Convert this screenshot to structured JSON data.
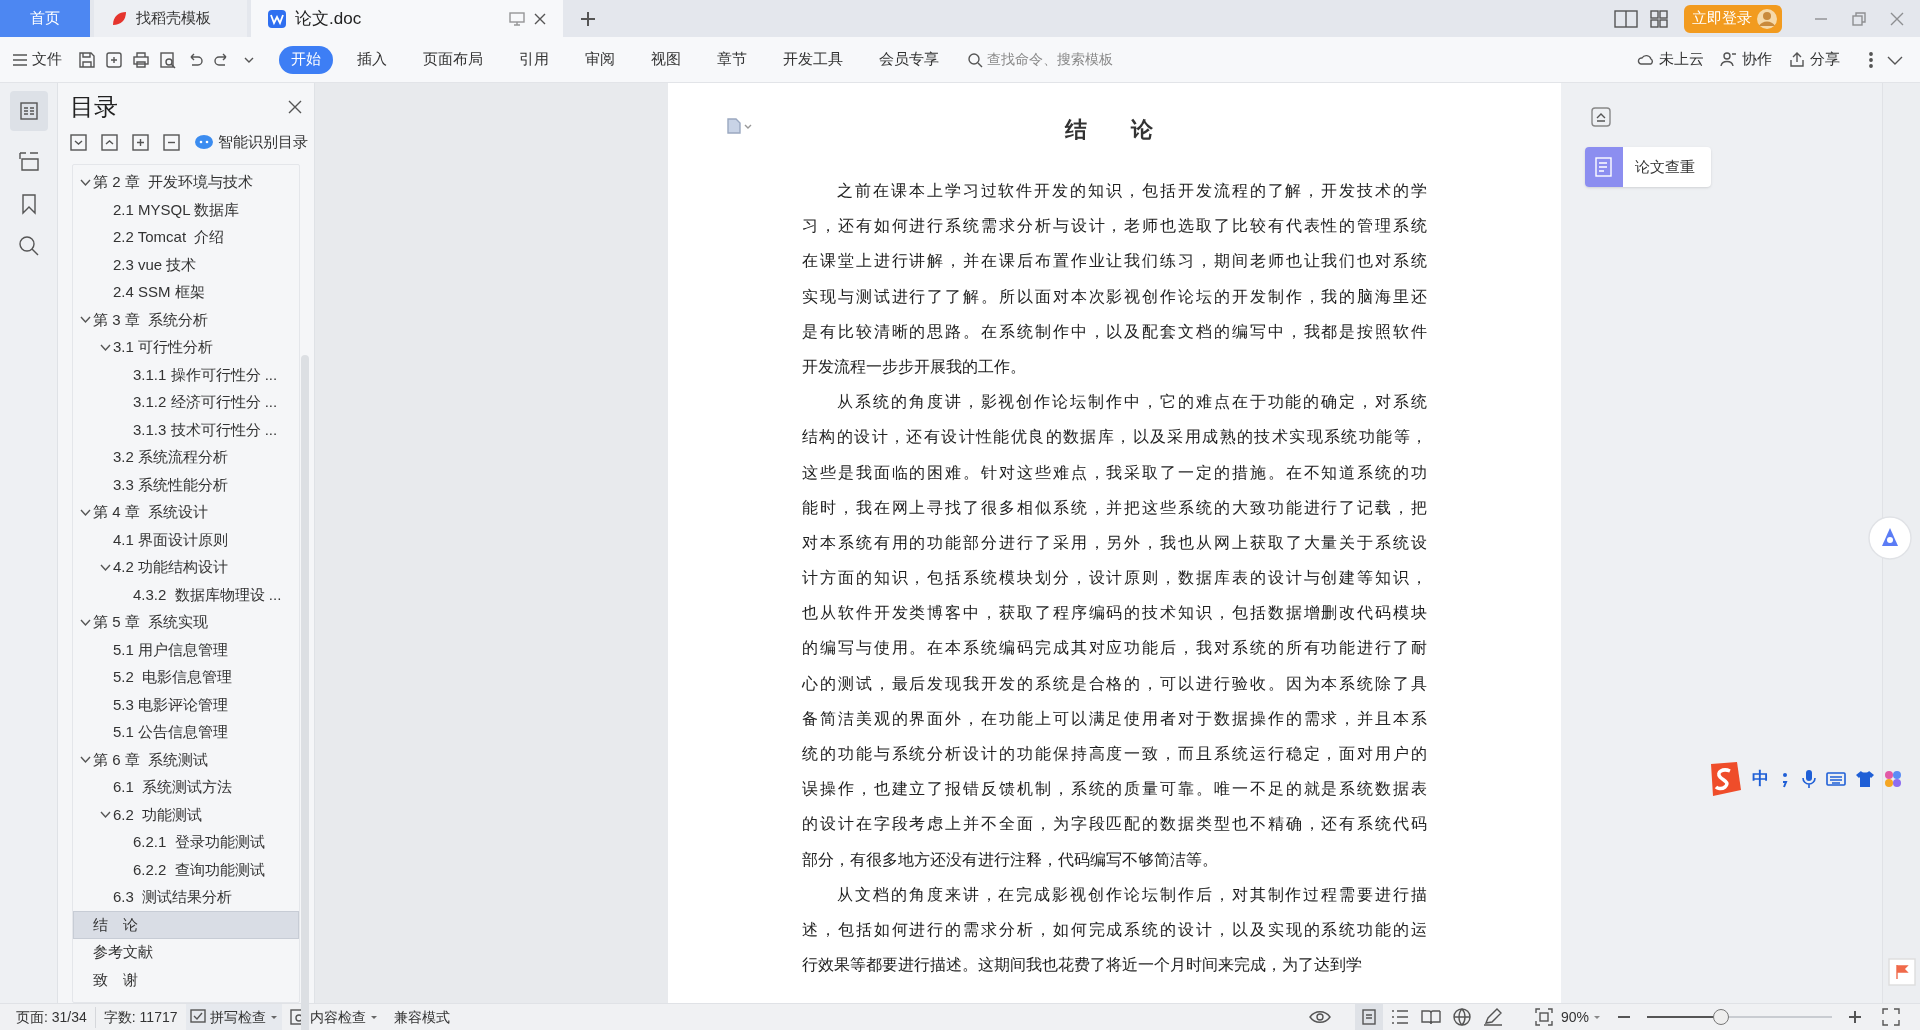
{
  "tabs": [
    {
      "label": "首页",
      "kind": "home",
      "selected": false
    },
    {
      "label": "找稻壳模板",
      "kind": "template",
      "selected": false
    },
    {
      "label": "论文.doc",
      "kind": "document",
      "selected": true
    }
  ],
  "login_button": "立即登录",
  "toolbar": {
    "file_menu": "文件",
    "tabs": [
      {
        "label": "开始",
        "selected": true
      },
      {
        "label": "插入",
        "selected": false
      },
      {
        "label": "页面布局",
        "selected": false
      },
      {
        "label": "引用",
        "selected": false
      },
      {
        "label": "审阅",
        "selected": false
      },
      {
        "label": "视图",
        "selected": false
      },
      {
        "label": "章节",
        "selected": false
      },
      {
        "label": "开发工具",
        "selected": false
      },
      {
        "label": "会员专享",
        "selected": false
      }
    ],
    "search": {
      "placeholder": "查找命令、搜索模板"
    },
    "actions": [
      {
        "label": "未上云",
        "kind": "cloud"
      },
      {
        "label": "协作",
        "kind": "people"
      },
      {
        "label": "分享",
        "kind": "share"
      }
    ]
  },
  "outline": {
    "title": "目录",
    "smart_button": "智能识别目录",
    "items": [
      {
        "label": "第 2 章  开发环境与技术",
        "expanded": true,
        "selected": false,
        "children": [
          {
            "label": "2.1 MYSQL 数据库",
            "selected": false
          },
          {
            "label": "2.2 Tomcat  介绍",
            "selected": false
          },
          {
            "label": "2.3 vue 技术",
            "selected": false
          },
          {
            "label": "2.4 SSM 框架",
            "selected": false
          }
        ]
      },
      {
        "label": "第 3 章  系统分析",
        "expanded": true,
        "selected": false,
        "children": [
          {
            "label": "3.1 可行性分析",
            "expanded": true,
            "selected": false,
            "children": [
              {
                "label": "3.1.1 操作可行性分 ...",
                "selected": false
              },
              {
                "label": "3.1.2 经济可行性分 ...",
                "selected": false
              },
              {
                "label": "3.1.3 技术可行性分 ...",
                "selected": false
              }
            ]
          },
          {
            "label": "3.2 系统流程分析",
            "selected": false
          },
          {
            "label": "3.3 系统性能分析",
            "selected": false
          }
        ]
      },
      {
        "label": "第 4 章  系统设计",
        "expanded": true,
        "selected": false,
        "children": [
          {
            "label": "4.1 界面设计原则",
            "selected": false
          },
          {
            "label": "4.2 功能结构设计",
            "expanded": true,
            "selected": false,
            "children": [
              {
                "label": "4.3.2  数据库物理设 ...",
                "selected": false
              }
            ]
          }
        ]
      },
      {
        "label": "第 5 章  系统实现",
        "expanded": true,
        "selected": false,
        "children": [
          {
            "label": "5.1 用户信息管理",
            "selected": false
          },
          {
            "label": "5.2  电影信息管理",
            "selected": false
          },
          {
            "label": "5.3 电影评论管理",
            "selected": false
          },
          {
            "label": "5.1 公告信息管理",
            "selected": false
          }
        ]
      },
      {
        "label": "第 6 章  系统测试",
        "expanded": true,
        "selected": false,
        "children": [
          {
            "label": "6.1  系统测试方法",
            "selected": false
          },
          {
            "label": "6.2  功能测试",
            "expanded": true,
            "selected": false,
            "children": [
              {
                "label": "6.2.1  登录功能测试",
                "selected": false
              },
              {
                "label": "6.2.2  查询功能测试",
                "selected": false
              }
            ]
          },
          {
            "label": "6.3  测试结果分析",
            "selected": false
          }
        ]
      },
      {
        "label": "结　论",
        "selected": true
      },
      {
        "label": "参考文献",
        "selected": false
      },
      {
        "label": "致　谢",
        "selected": false
      }
    ]
  },
  "document": {
    "title": "结　论",
    "paragraphs": [
      {
        "lines": [
          "之前在课本上学习过软件开发的知识，包括开发流程的了解，开发技术的学",
          "习，还有如何进行系统需求分析与设计，老师也选取了比较有代表性的管理系统",
          "在课堂上进行讲解，并在课后布置作业让我们练习，期间老师也让我们也对系统",
          "实现与测试进行了了解。所以面对本次影视创作论坛的开发制作，我的脑海里还",
          "是有比较清晰的思路。在系统制作中，以及配套文档的编写中，我都是按照软件",
          "开发流程一步步开展我的工作。"
        ]
      },
      {
        "lines": [
          "从系统的角度讲，影视创作论坛制作中，它的难点在于功能的确定，对系统",
          "结构的设计，还有设计性能优良的数据库，以及采用成熟的技术实现系统功能等，",
          "这些是我面临的困难。针对这些难点，我采取了一定的措施。在不知道系统的功",
          "能时，我在网上寻找了很多相似系统，并把这些系统的大致功能进行了记载，把",
          "对本系统有用的功能部分进行了采用，另外，我也从网上获取了大量关于系统设",
          "计方面的知识，包括系统模块划分，设计原则，数据库表的设计与创建等知识，",
          "也从软件开发类博客中，获取了程序编码的技术知识，包括数据增删改代码模块",
          "的编写与使用。在本系统编码完成其对应功能后，我对系统的所有功能进行了耐",
          "心的测试，最后发现我开发的系统是合格的，可以进行验收。因为本系统除了具",
          "备简洁美观的界面外，在功能上可以满足使用者对于数据操作的需求，并且本系",
          "统的功能与系统分析设计的功能保持高度一致，而且系统运行稳定，面对用户的",
          "误操作，也建立了报错反馈机制，系统的质量可靠。唯一不足的就是系统数据表",
          "的设计在字段考虑上并不全面，为字段匹配的数据类型也不精确，还有系统代码",
          "部分，有很多地方还没有进行注释，代码编写不够简洁等。"
        ]
      },
      {
        "lines": [
          "从文档的角度来讲，在完成影视创作论坛制作后，对其制作过程需要进行描",
          "述，包括如何进行的需求分析，如何完成系统的设计，以及实现的系统功能的运",
          "行效果等都要进行描述。这期间我也花费了将近一个月时间来完成，为了达到学"
        ]
      }
    ]
  },
  "right_panel": {
    "button": "论文查重"
  },
  "ime": {
    "label": "中"
  },
  "status_bar": {
    "page": "页面: 31/34",
    "words": "字数: 11717",
    "spell_check": "拼写检查",
    "content_check": "内容检查",
    "mode": "兼容模式",
    "zoom": "90%",
    "zoom_slider": {
      "level": 0.39
    }
  }
}
